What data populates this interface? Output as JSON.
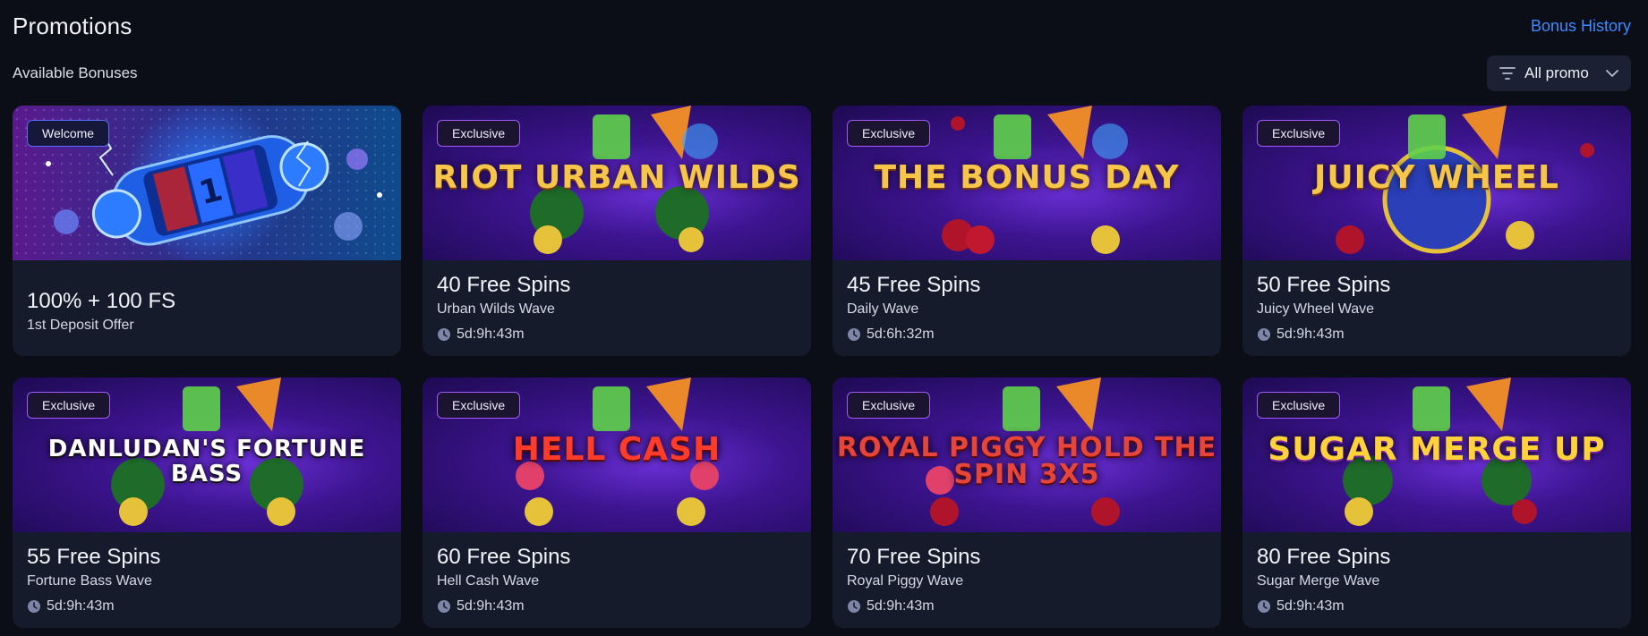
{
  "header": {
    "title": "Promotions",
    "bonus_history": "Bonus History"
  },
  "section": {
    "title": "Available Bonuses",
    "filter_label": "All promo"
  },
  "colors": {
    "background": "#0b0d17",
    "card": "#161b2b",
    "accent_link": "#3d8bff",
    "badge_border": "#a259ff"
  },
  "cards": [
    {
      "badge": "Welcome",
      "title": "100% + 100 FS",
      "subtitle": "1st Deposit Offer",
      "timer": "",
      "art_icon": "slot-reel-icon"
    },
    {
      "badge": "Exclusive",
      "title": "40 Free Spins",
      "subtitle": "Urban Wilds Wave",
      "timer": "5d:9h:43m",
      "logo": "RIOT URBAN WILDS"
    },
    {
      "badge": "Exclusive",
      "title": "45 Free Spins",
      "subtitle": "Daily Wave",
      "timer": "5d:6h:32m",
      "logo": "THE BONUS DAY"
    },
    {
      "badge": "Exclusive",
      "title": "50 Free Spins",
      "subtitle": "Juicy Wheel Wave",
      "timer": "5d:9h:43m",
      "logo": "JUICY WHEEL"
    },
    {
      "badge": "Exclusive",
      "title": "55 Free Spins",
      "subtitle": "Fortune Bass Wave",
      "timer": "5d:9h:43m",
      "logo": "DANLUDAN'S FORTUNE BASS"
    },
    {
      "badge": "Exclusive",
      "title": "60 Free Spins",
      "subtitle": "Hell Cash Wave",
      "timer": "5d:9h:43m",
      "logo": "HELL CASH"
    },
    {
      "badge": "Exclusive",
      "title": "70 Free Spins",
      "subtitle": "Royal Piggy Wave",
      "timer": "5d:9h:43m",
      "logo": "ROYAL PIGGY HOLD THE SPIN 3X5"
    },
    {
      "badge": "Exclusive",
      "title": "80 Free Spins",
      "subtitle": "Sugar Merge Wave",
      "timer": "5d:9h:43m",
      "logo": "SUGAR MERGE UP"
    }
  ]
}
